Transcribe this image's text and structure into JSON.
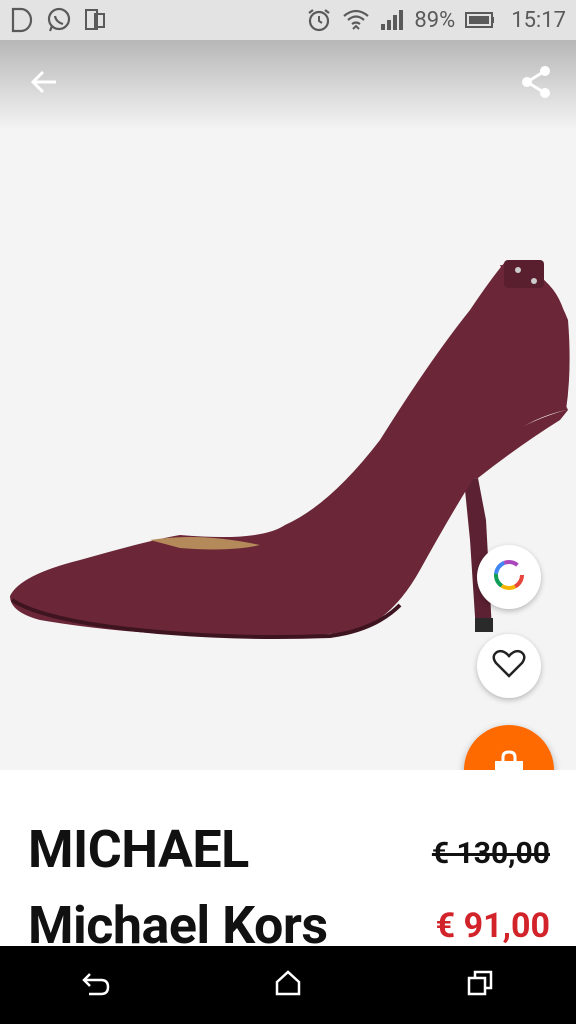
{
  "status_bar": {
    "time": "15:17",
    "battery": "89%",
    "icons": [
      "d-letter-icon",
      "whatsapp-icon",
      "phone-sync-icon",
      "alarm-icon",
      "wifi-icon",
      "signal-icon",
      "battery-icon"
    ]
  },
  "product": {
    "brand": "MICHAEL Michael Kors",
    "price_original": "€ 130,00",
    "price_sale": "€ 91,00",
    "image_color": "#6b2738"
  },
  "actions": {
    "back": "back-arrow-icon",
    "share": "share-icon",
    "color": "color-wheel-icon",
    "wishlist": "heart-icon",
    "cart": "shopping-bag-icon"
  },
  "colors": {
    "accent": "#ff6a00",
    "sale_price": "#d2232a"
  }
}
